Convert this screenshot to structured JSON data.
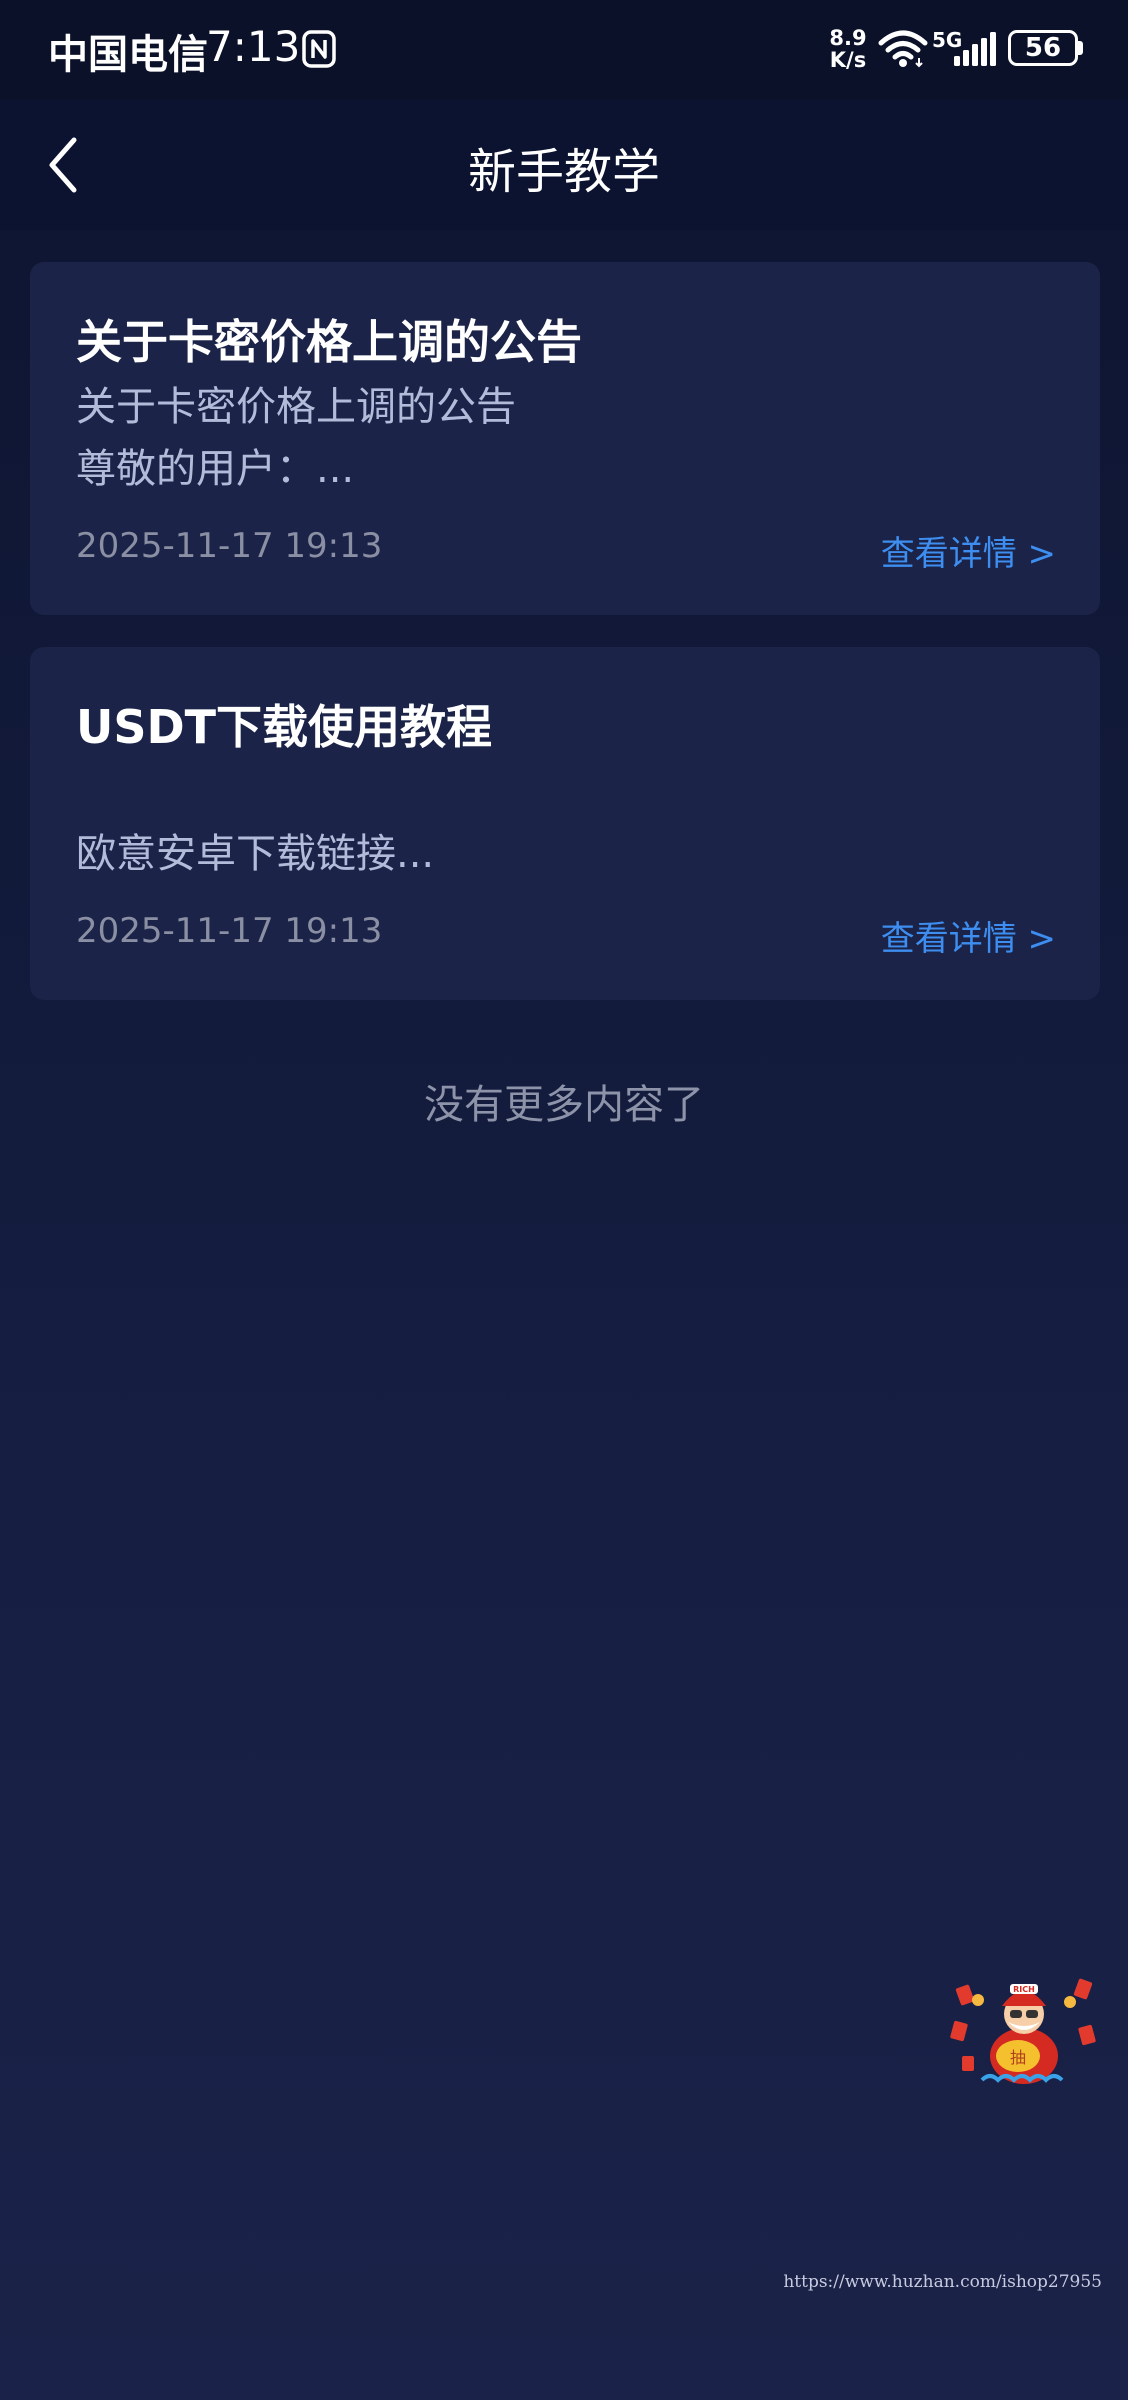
{
  "status_bar": {
    "carrier": "中国电信",
    "time": "7:13",
    "net_speed_value": "8.9",
    "net_speed_unit": "K/s",
    "network_type": "5G",
    "battery": "56",
    "icons": [
      "nfc-icon",
      "wifi-icon",
      "signal-icon",
      "battery-icon"
    ]
  },
  "header": {
    "title": "新手教学",
    "back_icon": "chevron-left-icon"
  },
  "articles": [
    {
      "title": "关于卡密价格上调的公告",
      "line1": "关于卡密价格上调的公告",
      "line2": "尊敬的用户：...",
      "date": "2025-11-17 19:13",
      "link_label": "查看详情 >"
    },
    {
      "title": "USDT下载使用教程",
      "line1": "",
      "line2": "欧意安卓下载链接...",
      "date": "2025-11-17 19:13",
      "link_label": "查看详情 >"
    }
  ],
  "footer_text": "没有更多内容了",
  "floating_widget": {
    "badge_text": "RICH",
    "bag_text": "抽"
  },
  "watermark": "https://www.huzhan.com/ishop27955",
  "colors": {
    "background": "#121a3a",
    "card": "#1b2448",
    "link": "#3d8ef0",
    "muted": "#8a8fa3"
  }
}
